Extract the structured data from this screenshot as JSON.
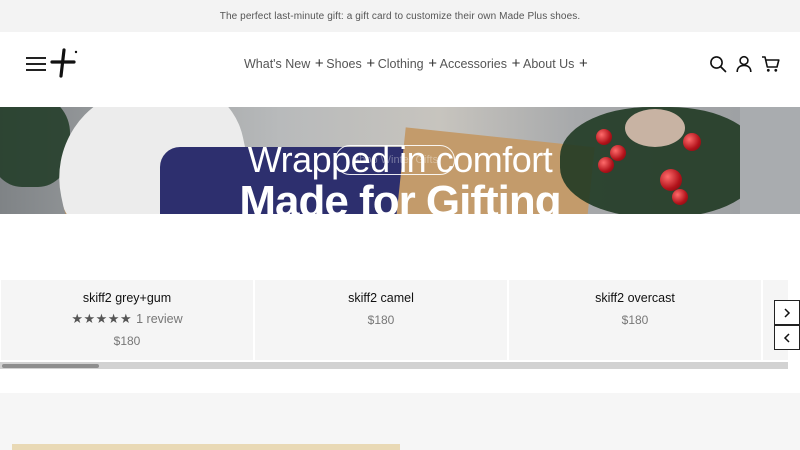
{
  "announcement": {
    "text": "The perfect last-minute gift: a gift card to customize their own Made Plus shoes."
  },
  "header": {
    "menu_icon": "hamburger-icon",
    "logo_icon": "plus-logo-icon",
    "nav": [
      {
        "label": "What's New"
      },
      {
        "label": "Shoes"
      },
      {
        "label": "Clothing"
      },
      {
        "label": "Accessories"
      },
      {
        "label": "About Us"
      }
    ],
    "icons": [
      "search-icon",
      "account-icon",
      "cart-icon"
    ]
  },
  "hero": {
    "title": "Wrapped in comfort",
    "subtitle": "Made for Gifting",
    "button_label": "Shop Winter Gifts"
  },
  "products": [
    {
      "name": "skiff2 grey+gum",
      "stars": "★★★★★",
      "rating": 5,
      "reviews": "1 review",
      "price": "$180"
    },
    {
      "name": "skiff2 camel",
      "price": "$180"
    },
    {
      "name": "skiff2 overcast",
      "price": "$180"
    }
  ],
  "carousel": {
    "next_icon": "chevron-right-icon",
    "prev_icon": "chevron-left-icon",
    "scroll_position": 0.12
  },
  "colors": {
    "announcement_bg": "#f3f3f3",
    "card_bg": "#f5f5f5",
    "text": "#222222",
    "muted": "#777777"
  }
}
